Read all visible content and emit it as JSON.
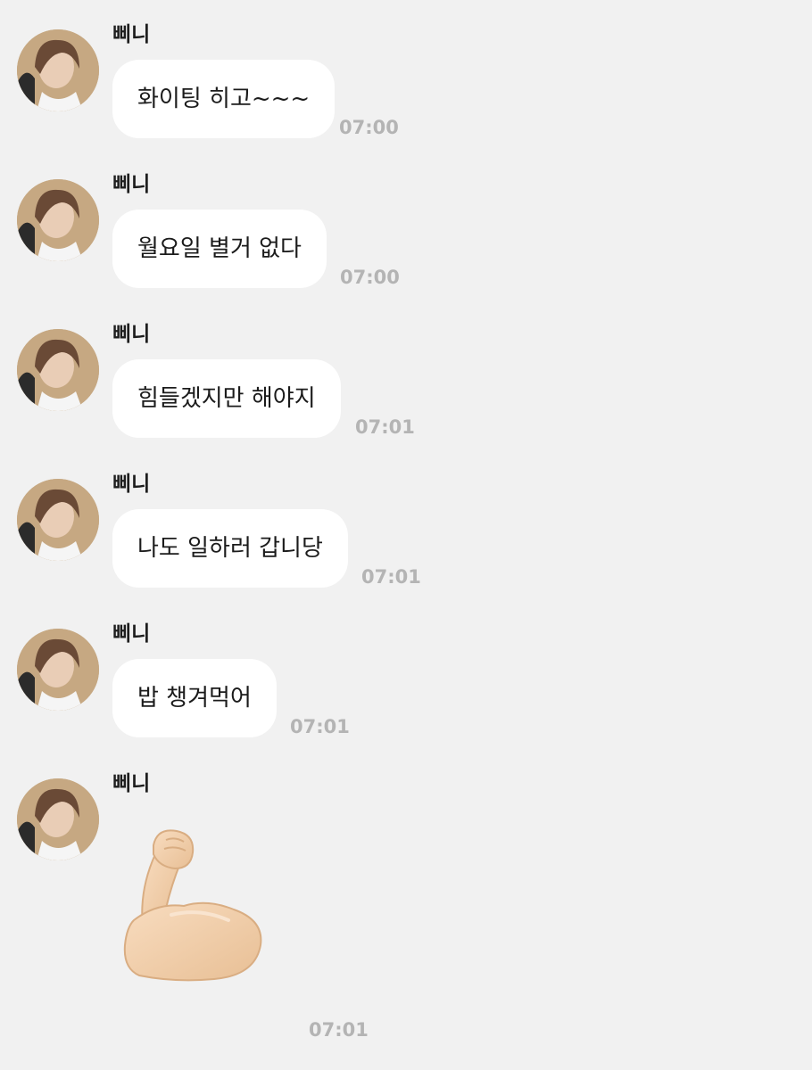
{
  "colors": {
    "background": "#f1f1f1",
    "bubble": "#ffffff",
    "timestamp": "#b4b4b4",
    "text": "#1b1b1b"
  },
  "messages": [
    {
      "sender": "삐니",
      "text": "화이팅 히고~~~",
      "time": "07:00"
    },
    {
      "sender": "삐니",
      "text": "월요일 별거 없다",
      "time": "07:00"
    },
    {
      "sender": "삐니",
      "text": "힘들겠지만 해야지",
      "time": "07:01"
    },
    {
      "sender": "삐니",
      "text": "나도 일하러 갑니당",
      "time": "07:01"
    },
    {
      "sender": "삐니",
      "text": "밥 챙겨먹어",
      "time": "07:01"
    },
    {
      "sender": "삐니",
      "sticker": "flexed-biceps-icon",
      "time": "07:01"
    }
  ]
}
